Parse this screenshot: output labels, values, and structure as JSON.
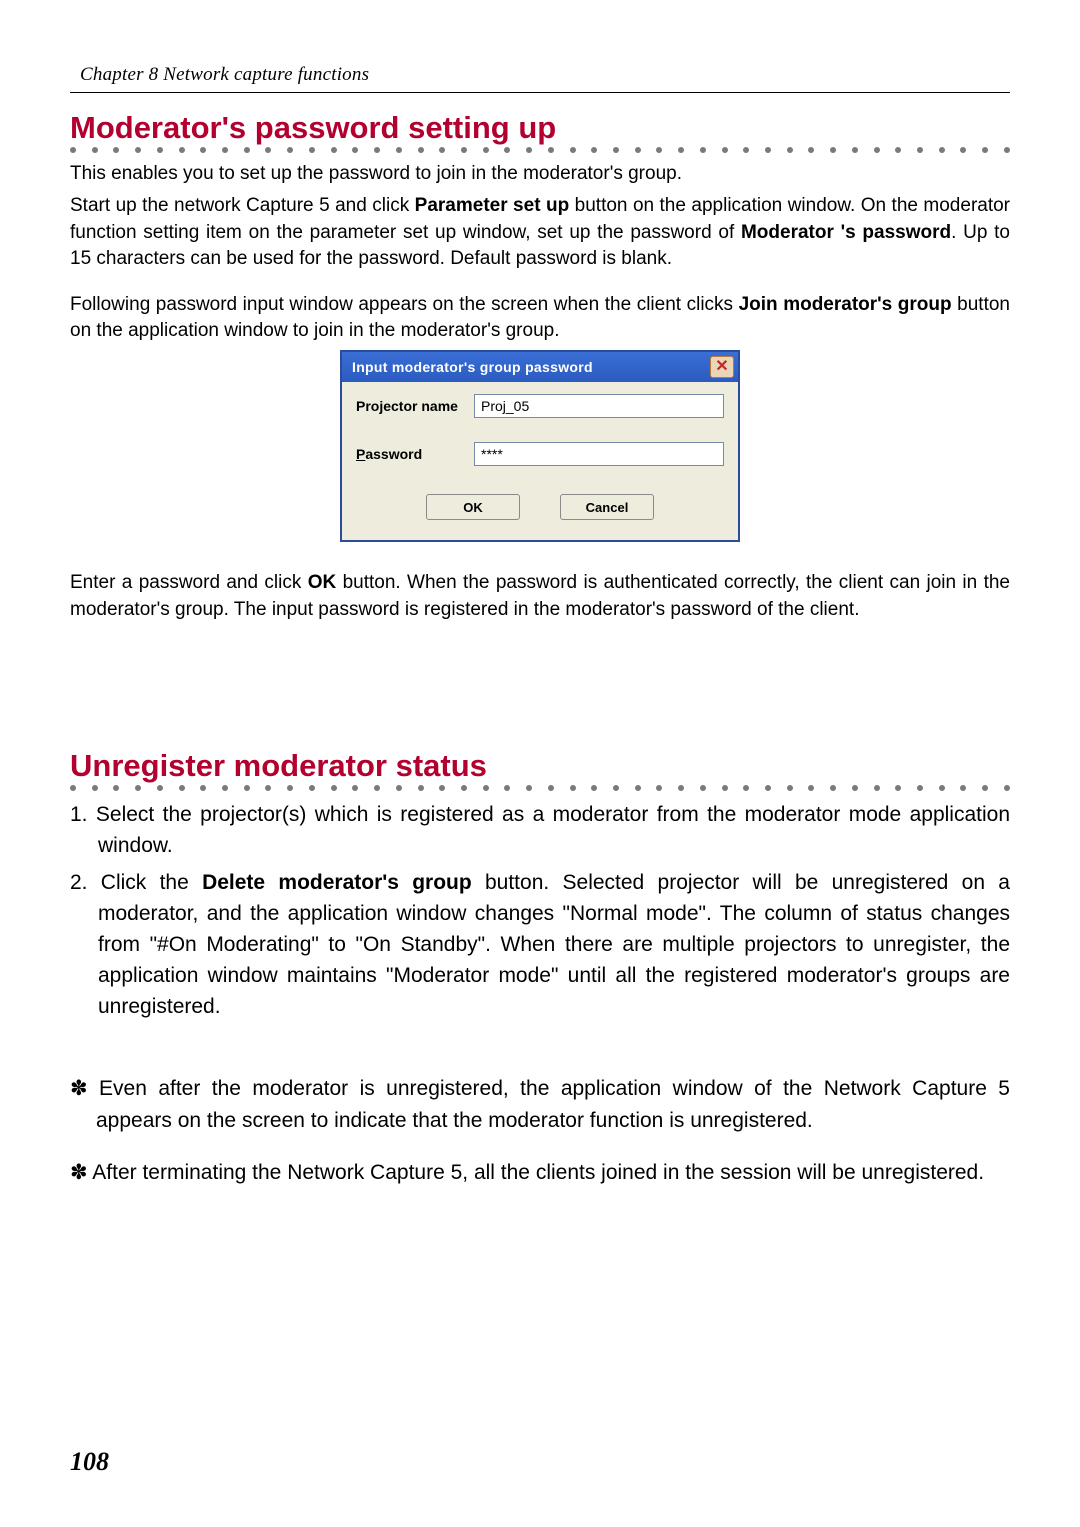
{
  "header": {
    "chapter": "Chapter 8 Network capture functions"
  },
  "section1": {
    "title": "Moderator's password setting up",
    "p1": "This enables you to set up the password to join in the moderator's group.",
    "p2_a": "Start up the network Capture 5 and click ",
    "p2_b": "Parameter set up",
    "p2_c": " button on the application window. On the moderator function setting item on the parameter set up window, set up the password of ",
    "p2_d": "Moderator 's password",
    "p2_e": ". Up to 15 characters can be used for the password. Default  password is blank.",
    "p3_a": "Following password input window appears on the screen when the client clicks ",
    "p3_b": "Join moderator's group",
    "p3_c": " button on the application window to join in the moderator's group.",
    "p4_a": "Enter a password and click ",
    "p4_b": "OK",
    "p4_c": " button. When the password is authenticated correctly, the client can join in the moderator's group. The input password is registered in the moderator's password of the client."
  },
  "dialog": {
    "title": "Input moderator's group password",
    "projector_label": "Projector name",
    "projector_value": "Proj_05",
    "password_label_ul": "P",
    "password_label_rest": "assword",
    "password_value": "****",
    "ok": "OK",
    "cancel": "Cancel",
    "close_glyph": "✕"
  },
  "section2": {
    "title": "Unregister moderator status",
    "li1": "1. Select the projector(s) which is registered as a moderator from the moderator mode application window.",
    "li2_a": "2. Click the ",
    "li2_b": "Delete moderator's group",
    "li2_c": " button. Selected projector will be unregistered on a moderator, and the application window changes \"Normal mode\".  The column of status changes from \"#On Moderating\" to \"On Standby\". When there are multiple projectors to unregister, the application window maintains \"Moderator mode\" until all the registered moderator's groups are unregistered.",
    "note1": "✽ Even after the moderator is unregistered, the application window of the Network Capture 5 appears on the screen to indicate that the moderator function is unregistered.",
    "note2": "✽ After terminating the Network Capture 5, all the clients joined in the session will be unregistered."
  },
  "page_number": "108",
  "dot_count": 44
}
